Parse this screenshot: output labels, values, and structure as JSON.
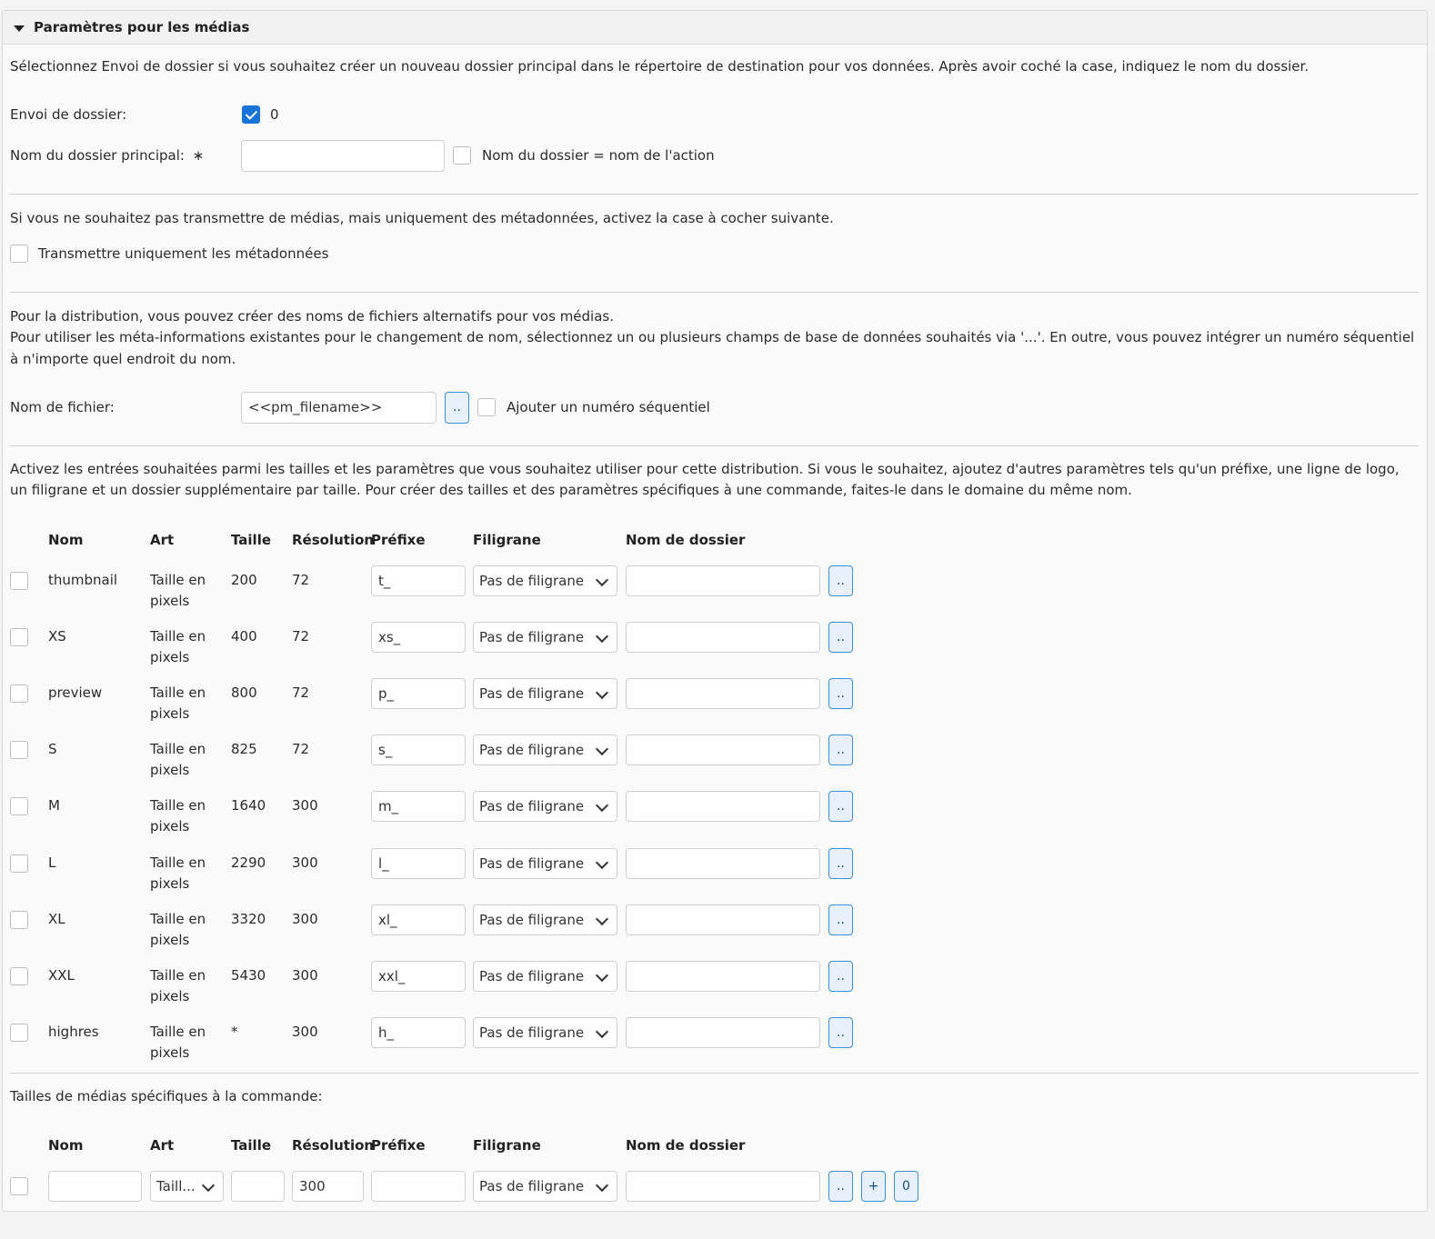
{
  "panel": {
    "title": "Paramètres pour les médias",
    "intro": "Sélectionnez Envoi de dossier si vous souhaitez créer un nouveau dossier principal dans le répertoire de destination pour vos données. Après avoir coché la case, indiquez le nom du dossier."
  },
  "folder_send": {
    "label": "Envoi de dossier:",
    "checked": true,
    "value": "0"
  },
  "main_folder": {
    "label": "Nom du dossier principal:",
    "required_mark": "∗",
    "value": "",
    "same_as_action_label": "Nom du dossier = nom de l'action"
  },
  "metadata": {
    "info": "Si vous ne souhaitez pas transmettre de médias, mais uniquement des métadonnées, activez la case à cocher suivante.",
    "checkbox_label": "Transmettre uniquement les métadonnées"
  },
  "filename": {
    "info_line1": "Pour la distribution, vous pouvez créer des noms de fichiers alternatifs pour vos médias.",
    "info_line2": "Pour utiliser les méta-informations existantes pour le changement de nom, sélectionnez un ou plusieurs champs de base de données souhaités via '...'. En outre, vous pouvez intégrer un numéro séquentiel à n'importe quel endroit du nom.",
    "label": "Nom de fichier:",
    "value": "<<pm_filename>>",
    "browse_label": "..",
    "sequential_label": "Ajouter un numéro séquentiel"
  },
  "sizes": {
    "info": "Activez les entrées souhaitées parmi les tailles et les paramètres que vous souhaitez utiliser pour cette distribution. Si vous le souhaitez, ajoutez d'autres paramètres tels qu'un préfixe, une ligne de logo, un filigrane et un dossier supplémentaire par taille. Pour créer des tailles et des paramètres spécifiques à une commande, faites-le dans le domaine du même nom.",
    "headers": {
      "name": "Nom",
      "art": "Art",
      "size": "Taille",
      "resolution": "Résolution",
      "prefix": "Préfixe",
      "watermark": "Filigrane",
      "folder": "Nom de dossier"
    },
    "rows": [
      {
        "name": "thumbnail",
        "art_line1": "Taille en",
        "art_line2": "pixels",
        "size": "200",
        "resolution": "72",
        "prefix": "t_",
        "watermark": "Pas de filigrane",
        "folder": "",
        "browse": ".."
      },
      {
        "name": "XS",
        "art_line1": "Taille en",
        "art_line2": "pixels",
        "size": "400",
        "resolution": "72",
        "prefix": "xs_",
        "watermark": "Pas de filigrane",
        "folder": "",
        "browse": ".."
      },
      {
        "name": "preview",
        "art_line1": "Taille en",
        "art_line2": "pixels",
        "size": "800",
        "resolution": "72",
        "prefix": "p_",
        "watermark": "Pas de filigrane",
        "folder": "",
        "browse": ".."
      },
      {
        "name": "S",
        "art_line1": "Taille en",
        "art_line2": "pixels",
        "size": "825",
        "resolution": "72",
        "prefix": "s_",
        "watermark": "Pas de filigrane",
        "folder": "",
        "browse": ".."
      },
      {
        "name": "M",
        "art_line1": "Taille en",
        "art_line2": "pixels",
        "size": "1640",
        "resolution": "300",
        "prefix": "m_",
        "watermark": "Pas de filigrane",
        "folder": "",
        "browse": ".."
      },
      {
        "name": "L",
        "art_line1": "Taille en",
        "art_line2": "pixels",
        "size": "2290",
        "resolution": "300",
        "prefix": "l_",
        "watermark": "Pas de filigrane",
        "folder": "",
        "browse": ".."
      },
      {
        "name": "XL",
        "art_line1": "Taille en",
        "art_line2": "pixels",
        "size": "3320",
        "resolution": "300",
        "prefix": "xl_",
        "watermark": "Pas de filigrane",
        "folder": "",
        "browse": ".."
      },
      {
        "name": "XXL",
        "art_line1": "Taille en",
        "art_line2": "pixels",
        "size": "5430",
        "resolution": "300",
        "prefix": "xxl_",
        "watermark": "Pas de filigrane",
        "folder": "",
        "browse": ".."
      },
      {
        "name": "highres",
        "art_line1": "Taille en",
        "art_line2": "pixels",
        "size": "*",
        "resolution": "300",
        "prefix": "h_",
        "watermark": "Pas de filigrane",
        "folder": "",
        "browse": ".."
      }
    ]
  },
  "order_sizes": {
    "label": "Tailles de médias spécifiques à la commande:",
    "headers": {
      "name": "Nom",
      "art": "Art",
      "size": "Taille",
      "resolution": "Résolution",
      "prefix": "Préfixe",
      "watermark": "Filigrane",
      "folder": "Nom de dossier"
    },
    "row": {
      "name": "",
      "art": "Taill...",
      "size": "",
      "resolution": "300",
      "prefix": "",
      "watermark": "Pas de filigrane",
      "folder": "",
      "browse": "..",
      "add": "+",
      "count": "0"
    }
  }
}
